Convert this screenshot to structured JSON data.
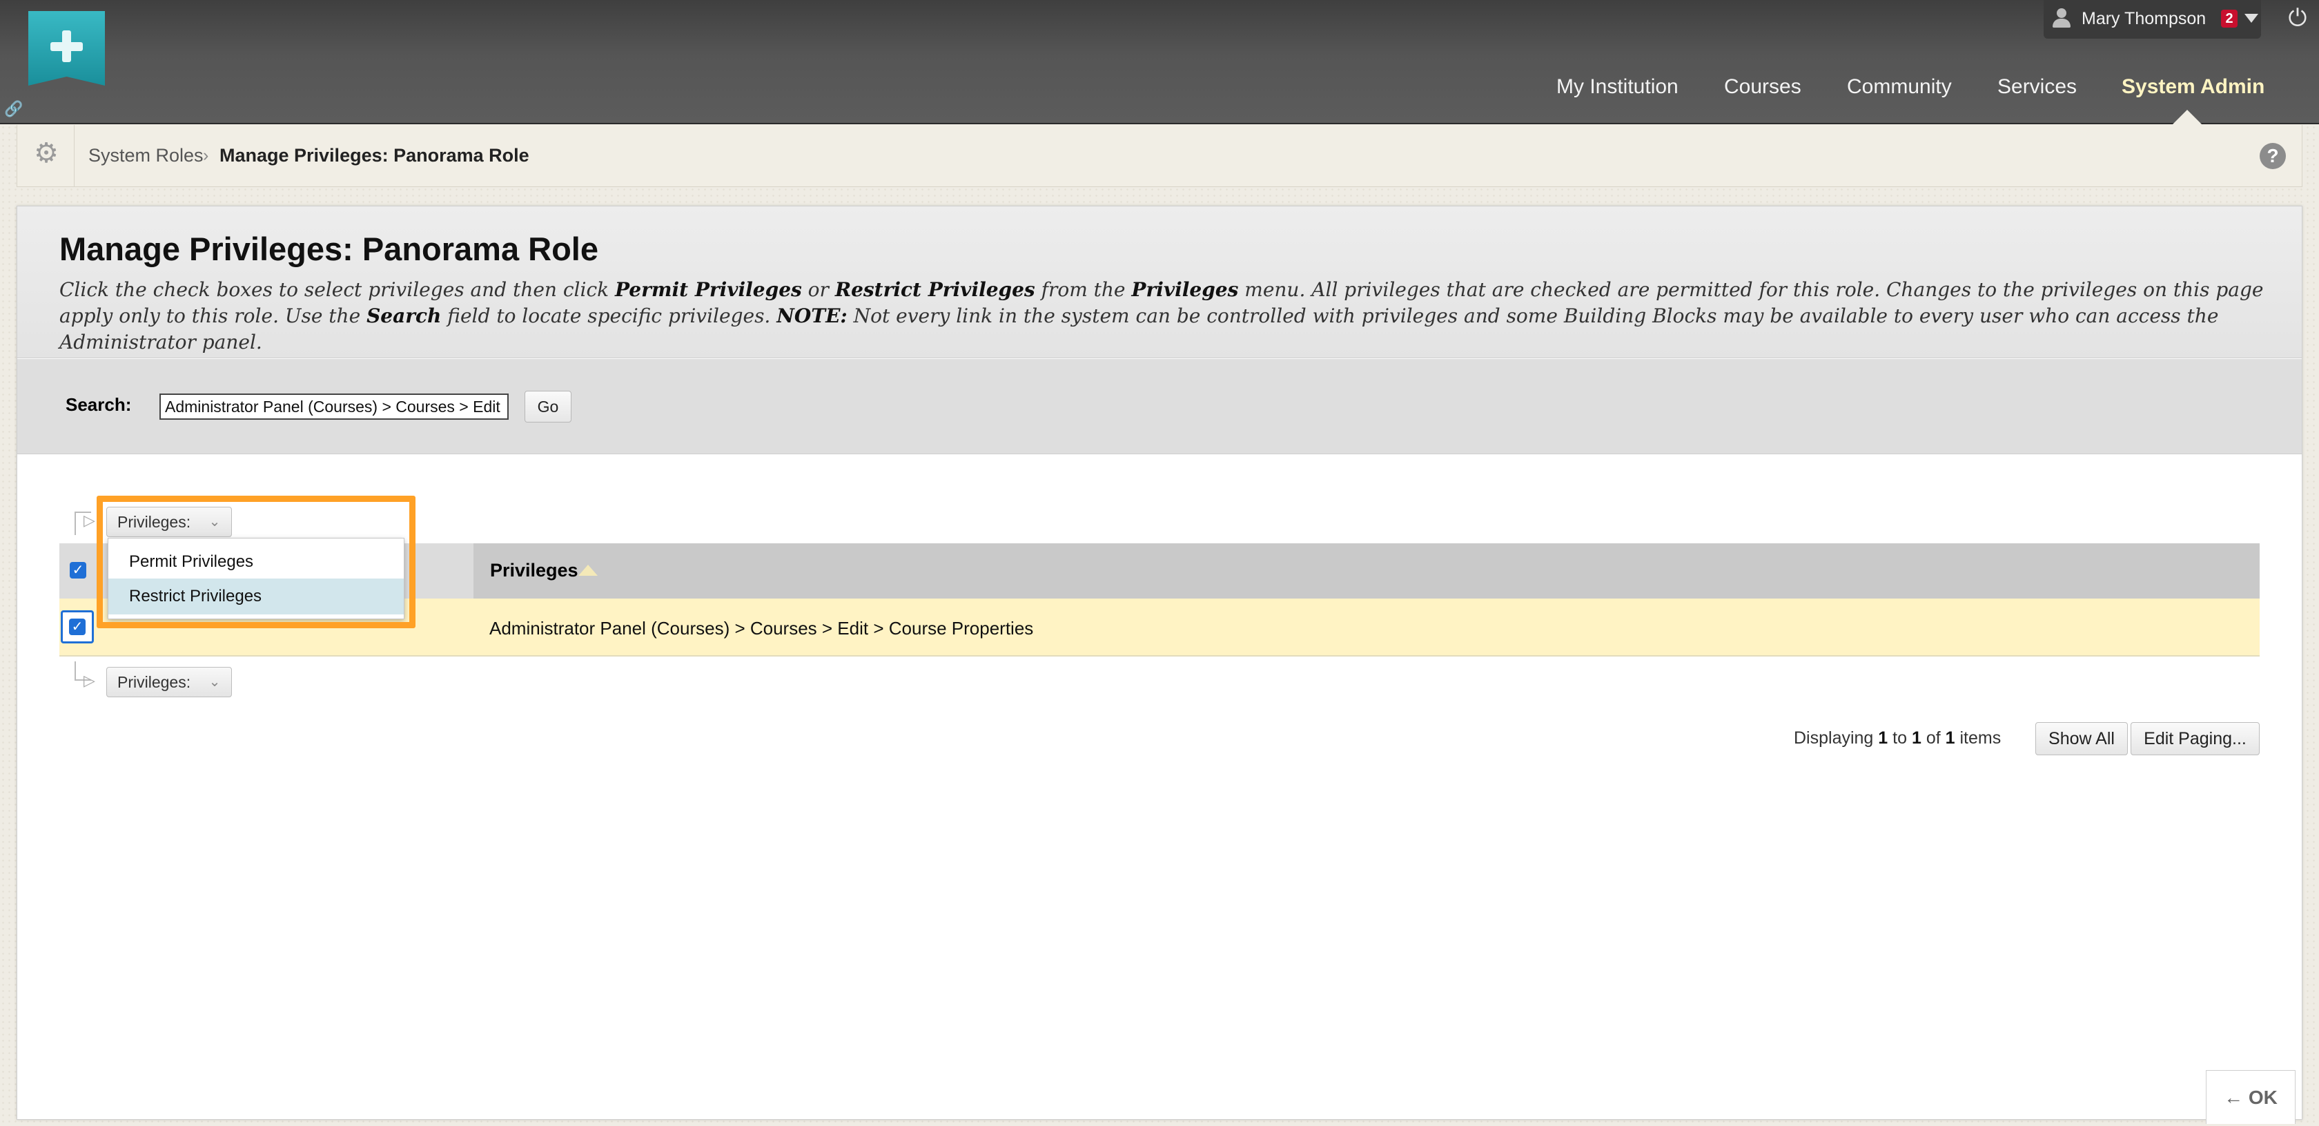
{
  "header": {
    "user_name": "Mary Thompson",
    "notification_count": "2",
    "nav_tabs": [
      {
        "label": "My Institution"
      },
      {
        "label": "Courses"
      },
      {
        "label": "Community"
      },
      {
        "label": "Services"
      },
      {
        "label": "System Admin"
      }
    ],
    "active_tab": "System Admin",
    "accent_color": "#1a8f9b"
  },
  "breadcrumb": {
    "items": [
      {
        "label": "System Roles"
      },
      {
        "label": "Manage Privileges: Panorama Role"
      }
    ],
    "separator": "›"
  },
  "page": {
    "title": "Manage Privileges: Panorama Role",
    "instructions": {
      "p1": "Click the check boxes to select privileges and then click ",
      "b1": "Permit Privileges",
      "p2": " or ",
      "b2": "Restrict Privileges",
      "p3": " from the ",
      "b3": "Privileges",
      "p4": " menu. All privileges that are checked are permitted for this role. Changes to the privileges on this page apply only to this role. Use the ",
      "b4": "Search",
      "p5": " field to locate specific privileges. ",
      "b5": "NOTE:",
      "p6": " Not every link in the system can be controlled with privileges and some Building Blocks may be available to every user who can access the Administrator panel."
    }
  },
  "search": {
    "label": "Search:",
    "value": "Administrator Panel (Courses) > Courses > Edit",
    "go_label": "Go"
  },
  "actions": {
    "menu_label": "Privileges:",
    "menu_items": [
      {
        "label": "Permit Privileges"
      },
      {
        "label": "Restrict Privileges"
      }
    ],
    "highlight_color": "#ffa126"
  },
  "table": {
    "column_header": "Privileges",
    "rows": [
      {
        "label": "Administrator Panel (Courses) > Courses > Edit > Course Properties",
        "checked": true
      }
    ]
  },
  "paging": {
    "text_displaying": "Displaying",
    "from": "1",
    "text_to": "to",
    "to": "1",
    "text_of": "of",
    "total": "1",
    "text_items": "items",
    "show_all_label": "Show All",
    "edit_paging_label": "Edit Paging..."
  },
  "footer": {
    "ok_label": "← OK"
  }
}
